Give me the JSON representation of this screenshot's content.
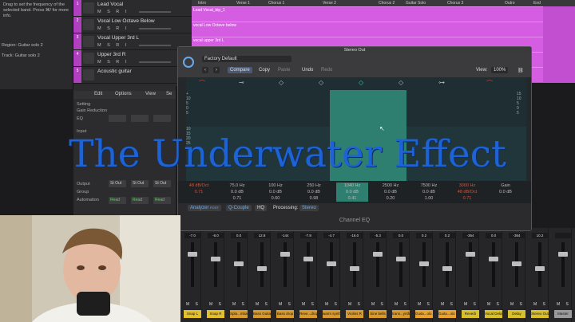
{
  "info_panel": {
    "text": "Drag to set the frequency of the selected band. Press ⌘/ for more info.",
    "region_label": "Region: Guitar solo 2",
    "track_label": "Track: Guitar solo 2"
  },
  "tracks": [
    {
      "num": "1",
      "name": "Lead Vocal",
      "ms": "M S R I"
    },
    {
      "num": "2",
      "name": "Vocal Low Octave Below",
      "ms": "M S R I"
    },
    {
      "num": "3",
      "name": "Vocal Upper 3rd L",
      "ms": "M S R I"
    },
    {
      "num": "4",
      "name": "Upper 3rd R",
      "ms": "M S R I"
    },
    {
      "num": "5",
      "name": "Acoustic guitar",
      "ms": ""
    }
  ],
  "ruler": [
    "Intro",
    "Verse 1",
    "Chorus 1",
    "Verse 2",
    "Chorus 2",
    "Guitar Solo",
    "Chorus 3",
    "Outro",
    "End"
  ],
  "regions": [
    "Lead Vocal_bip_1",
    "vocal Low Octave below",
    "vocal upper 3rd L",
    "",
    ""
  ],
  "mixer_left": {
    "menu": [
      "Edit",
      "Options",
      "View",
      "Se"
    ],
    "rows": [
      "Setting",
      "Gain Reduction",
      "EQ",
      "Input",
      "Output",
      "Group",
      "Automation"
    ],
    "output_slots": [
      "St Out",
      "St Out",
      "St Out"
    ],
    "read_labels": [
      "Read",
      "Read",
      "Read"
    ],
    "stereo_out": "Stereo Out"
  },
  "eq": {
    "window_title": "Stereo Out",
    "preset": "Factory Default",
    "toolbar": {
      "compare": "Compare",
      "copy": "Copy",
      "paste": "Paste",
      "undo": "Undo",
      "redo": "Redo",
      "view_label": "View:",
      "zoom": "100%"
    },
    "db_left": [
      "+",
      "10",
      "5",
      "0",
      "5",
      "10",
      "15",
      "20",
      "25"
    ],
    "db_right": [
      "15",
      "10",
      "5",
      "0",
      "5",
      "10"
    ],
    "bands": [
      {
        "freq": "",
        "gain": "48 dB/Oct",
        "q": "0.71"
      },
      {
        "freq": "75.0 Hz",
        "gain": "0.0 dB",
        "q": "0.71"
      },
      {
        "freq": "100 Hz",
        "gain": "0.0 dB",
        "q": "0.60"
      },
      {
        "freq": "250 Hz",
        "gain": "0.0 dB",
        "q": "0.98"
      },
      {
        "freq": "1040 Hz",
        "gain": "0.0 dB",
        "q": "0.41"
      },
      {
        "freq": "2500 Hz",
        "gain": "0.0 dB",
        "q": "0.20"
      },
      {
        "freq": "7500 Hz",
        "gain": "0.0 dB",
        "q": "1.00"
      },
      {
        "freq": "3000 Hz",
        "gain": "48 dB/Oct",
        "q": "0.71"
      },
      {
        "freq": "Gain",
        "gain": "0.0 dB",
        "q": ""
      }
    ],
    "footer": {
      "analyzer": "Analyzer",
      "post": "POST",
      "qcouple": "Q-Couple",
      "hq": "HQ",
      "processing_label": "Processing:",
      "processing_value": "Stereo",
      "plugin_name": "Channel EQ"
    }
  },
  "headline": "The Underwater Effect",
  "mixer_strips": [
    {
      "val": "-7.0",
      "label": "Snap L",
      "color": "#e3c02b"
    },
    {
      "val": "-6.0",
      "label": "Snap R",
      "color": "#e3c02b"
    },
    {
      "val": "0.0",
      "label": "Spla...mbal",
      "color": "#d89a2c"
    },
    {
      "val": "12.8",
      "label": "Bass Guitar",
      "color": "#d89a2c"
    },
    {
      "val": "-144",
      "label": "Bass drop",
      "color": "#d89a2c"
    },
    {
      "val": "-7.8",
      "label": "Reve...drop",
      "color": "#d89a2c"
    },
    {
      "val": "-4.7",
      "label": "warm synth",
      "color": "#d89a2c"
    },
    {
      "val": "-16.0",
      "label": "Violins R",
      "color": "#d89a2c"
    },
    {
      "val": "-5.3",
      "label": "Sine bells",
      "color": "#d89a2c"
    },
    {
      "val": "0.0",
      "label": "trans...ynth",
      "color": "#d89a2c"
    },
    {
      "val": "0.2",
      "label": "Guita...olo 1",
      "color": "#e8a32f"
    },
    {
      "val": "0.2",
      "label": "Guita...olo 2",
      "color": "#e8a32f"
    },
    {
      "val": "-364",
      "label": "Reverb",
      "color": "#d8c02b"
    },
    {
      "val": "0.0",
      "label": "Vocal Delay",
      "color": "#d8c02b"
    },
    {
      "val": "-364",
      "label": "Delay",
      "color": "#d8c02b"
    },
    {
      "val": "10.2",
      "label": "Stereo Out",
      "color": "#d8c02b"
    },
    {
      "val": "",
      "label": "Master",
      "color": "#9a9a9a"
    }
  ],
  "bnc_label": "Bnc"
}
